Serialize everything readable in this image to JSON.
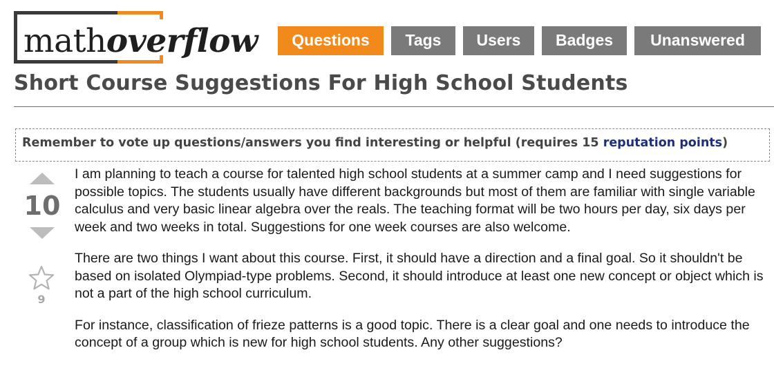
{
  "site": {
    "logo_part1": "math",
    "logo_part2": "overflow",
    "brand_color": "#f0891e"
  },
  "nav": {
    "items": [
      {
        "label": "Questions",
        "active": true
      },
      {
        "label": "Tags",
        "active": false
      },
      {
        "label": "Users",
        "active": false
      },
      {
        "label": "Badges",
        "active": false
      },
      {
        "label": "Unanswered",
        "active": false
      }
    ],
    "active_color": "#f18a1b",
    "inactive_color": "#7a7a7a"
  },
  "question": {
    "title": "Short Course Suggestions For High School Students",
    "votes": "10",
    "favorites": "9",
    "paragraphs": [
      "I am planning to teach a course for talented high school students at a summer camp and I need suggestions for possible topics. The students usually have different backgrounds but most of them are familiar with single variable calculus and very basic linear algebra over the reals. The teaching format will be two hours per day, six days per week and two weeks in total. Suggestions for one week courses are also welcome.",
      "There are two things I want about this course. First, it should have a direction and a final goal. So it shouldn't be based on isolated Olympiad-type problems. Second, it should introduce at least one new concept or object which is not a part of the high school curriculum.",
      "For instance, classification of frieze patterns is a good topic. There is a clear goal and one needs to introduce the concept of a group which is new for high school students. Any other suggestions?"
    ]
  },
  "notice": {
    "text_before": "Remember to vote up questions/answers you find interesting or helpful (requires 15 ",
    "link_text": "reputation points",
    "text_after": ")"
  },
  "icons": {
    "vote_up": "triangle-up-icon",
    "vote_down": "triangle-down-icon",
    "favorite": "star-outline-icon"
  }
}
